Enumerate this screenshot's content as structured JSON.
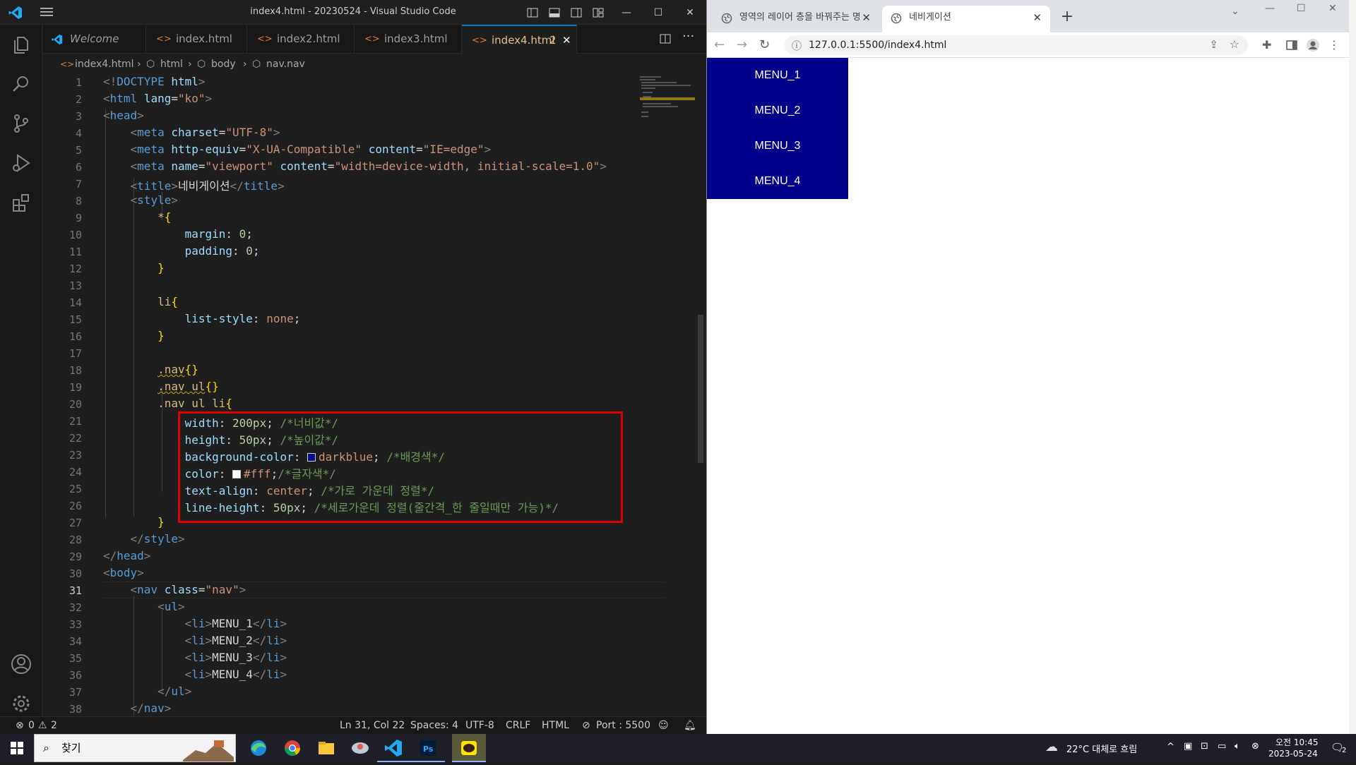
{
  "vscode": {
    "window_title": "index4.html - 20230524 - Visual Studio Code",
    "tabs": [
      {
        "label": "Welcome",
        "icon": "vscode-icon"
      },
      {
        "label": "index.html",
        "icon": "html-icon"
      },
      {
        "label": "index2.html",
        "icon": "html-icon"
      },
      {
        "label": "index3.html",
        "icon": "html-icon"
      },
      {
        "label": "index4.html",
        "icon": "html-icon",
        "problems": "2",
        "active": true
      }
    ],
    "breadcrumb": [
      "index4.html",
      "html",
      "body",
      "nav.nav"
    ],
    "line_numbers": [
      "1",
      "2",
      "3",
      "4",
      "5",
      "6",
      "7",
      "8",
      "9",
      "10",
      "11",
      "12",
      "13",
      "14",
      "15",
      "16",
      "17",
      "18",
      "19",
      "20",
      "21",
      "22",
      "23",
      "24",
      "25",
      "26",
      "27",
      "28",
      "29",
      "30",
      "31",
      "32",
      "33",
      "34",
      "35",
      "36",
      "37",
      "38"
    ],
    "current_line": "31",
    "code": {
      "l1_a": "<!",
      "l1_b": "DOCTYPE",
      "l1_c": " html",
      "l1_d": ">",
      "l2_a": "html",
      "l2_attr": "lang",
      "l2_val": "\"ko\"",
      "l3": "head",
      "l4_tag": "meta",
      "l4_attr": "charset",
      "l4_val": "\"UTF-8\"",
      "l5_tag": "meta",
      "l5_attr": "http-equiv",
      "l5_val": "\"X-UA-Compatible\"",
      "l5_attr2": "content",
      "l5_val2": "\"IE=edge\"",
      "l6_tag": "meta",
      "l6_attr": "name",
      "l6_val": "\"viewport\"",
      "l6_attr2": "content",
      "l6_val2": "\"width=device-width, initial-scale=1.0\"",
      "l7_tag": "title",
      "l7_text": "네비게이션",
      "l8": "style",
      "l9_sel": "*",
      "l10_prop": "margin",
      "l10_val": "0",
      "l11_prop": "padding",
      "l11_val": "0",
      "l14_sel": "li",
      "l15_prop": "list-style",
      "l15_val": "none",
      "l18_sel": ".nav",
      "l19_sel": ".nav ul",
      "l20_sel": ".nav ul li",
      "l21_prop": "width",
      "l21_val": "200px",
      "l21_com": "/*너비값*/",
      "l22_prop": "height",
      "l22_val": "50px",
      "l22_com": "/*높이값*/",
      "l23_prop": "background-color",
      "l23_val": "darkblue",
      "l23_com": "/*배경색*/",
      "l24_prop": "color",
      "l24_val": "#fff",
      "l24_com": "/*글자색*/",
      "l25_prop": "text-align",
      "l25_val": "center",
      "l25_com": "/*가로 가운데 정렬*/",
      "l26_prop": "line-height",
      "l26_val": "50px",
      "l26_com": "/*세로가운데 정렬(줄간격_한 줄일때만 가능)*/",
      "l28": "style",
      "l29": "head",
      "l30": "body",
      "l31_tag": "nav",
      "l31_attr": "class",
      "l31_val": "\"nav\"",
      "l32": "ul",
      "l33": "MENU_1",
      "l34": "MENU_2",
      "l35": "MENU_3",
      "l36": "MENU_4",
      "li": "li",
      "l37": "ul",
      "l38": "nav"
    },
    "status": {
      "errors": "0",
      "warnings": "2",
      "cursor": "Ln 31, Col 22",
      "spaces": "Spaces: 4",
      "encoding": "UTF-8",
      "eol": "CRLF",
      "language": "HTML",
      "port": "Port : 5500"
    }
  },
  "browser": {
    "tabs": [
      {
        "label": "영역의 레이어 층을 바꿔주는 명",
        "active": false
      },
      {
        "label": "네비게이션",
        "active": true
      }
    ],
    "url": "127.0.0.1:5500/index4.html",
    "menu_items": [
      "MENU_1",
      "MENU_2",
      "MENU_3",
      "MENU_4"
    ],
    "menu_bg": "#00008b",
    "menu_color": "#ffffff"
  },
  "taskbar": {
    "search_placeholder": "찾기",
    "weather": "22°C  대체로 흐림",
    "time": "오전 10:45",
    "date": "2023-05-24",
    "notification_count": "2"
  },
  "colors": {
    "accent": "#0078d4",
    "error_box": "#e00000"
  }
}
